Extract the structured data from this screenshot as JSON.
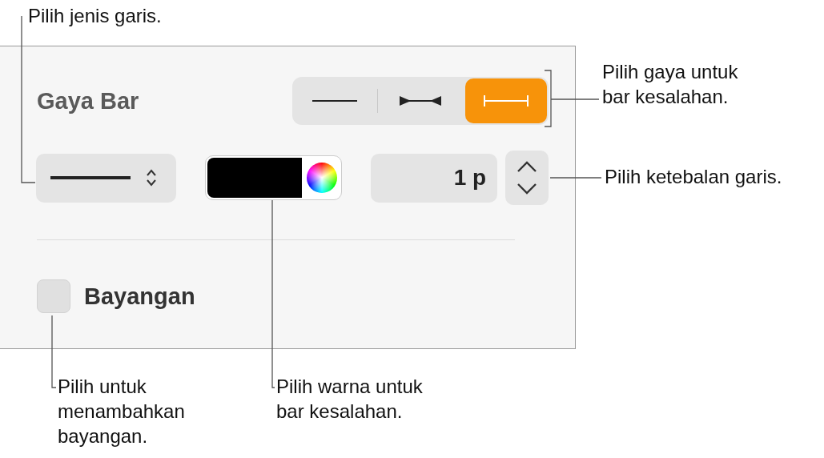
{
  "panel": {
    "title": "Gaya Bar",
    "bar_styles": [
      {
        "kind": "plain",
        "selected": false
      },
      {
        "kind": "arrows",
        "selected": false
      },
      {
        "kind": "caps",
        "selected": true
      }
    ],
    "color_well": {
      "color": "#000000"
    },
    "thickness": {
      "value": "1 p"
    },
    "shadow": {
      "label": "Bayangan",
      "checked": false
    }
  },
  "callouts": [
    {
      "text": "Pilih jenis garis."
    },
    {
      "text": "Pilih gaya untuk\nbar kesalahan."
    },
    {
      "text": "Pilih ketebalan garis."
    },
    {
      "text": "Pilih untuk\nmenambahkan\nbayangan."
    },
    {
      "text": "Pilih warna untuk\nbar kesalahan."
    }
  ]
}
